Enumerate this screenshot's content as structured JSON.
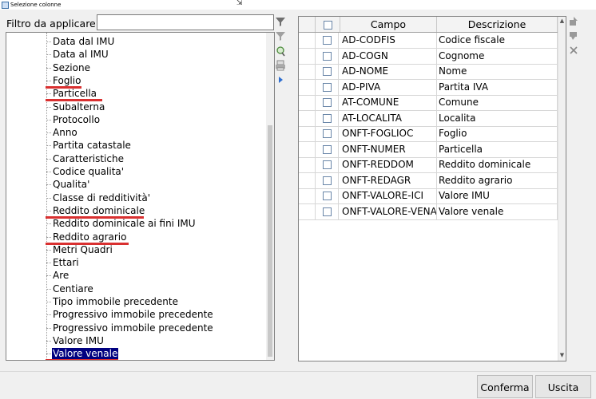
{
  "window": {
    "title": "Selezione colonne"
  },
  "filter": {
    "label": "Filtro da applicare",
    "value": ""
  },
  "tree": {
    "items": [
      "Data dal IMU",
      "Data al IMU",
      "Sezione",
      "Foglio",
      "Particella",
      "Subalterna",
      "Protocollo",
      "Anno",
      "Partita catastale",
      "Caratteristiche",
      "Codice qualita'",
      "Qualita'",
      "Classe di redditività'",
      "Reddito dominicale",
      "Reddito dominicale ai fini IMU",
      "Reddito agrario",
      "Metri Quadri",
      "Ettari",
      "Are",
      "Centiare",
      "Tipo immobile precedente",
      "Progressivo immobile precedente",
      "Progressivo immobile precedente",
      "Valore IMU",
      "Valore venale"
    ],
    "selected": "Valore venale",
    "highlighted": [
      "Foglio",
      "Particella",
      "Reddito dominicale",
      "Reddito agrario",
      "Valore venale"
    ],
    "highlight_color": "#d93030"
  },
  "grid": {
    "columns": {
      "campo": "Campo",
      "descrizione": "Descrizione"
    },
    "rows": [
      {
        "campo": "AD-CODFIS",
        "descrizione": "Codice fiscale"
      },
      {
        "campo": "AD-COGN",
        "descrizione": "Cognome"
      },
      {
        "campo": "AD-NOME",
        "descrizione": "Nome"
      },
      {
        "campo": "AD-PIVA",
        "descrizione": "Partita IVA"
      },
      {
        "campo": "AT-COMUNE",
        "descrizione": "Comune"
      },
      {
        "campo": "AT-LOCALITA",
        "descrizione": "Localita"
      },
      {
        "campo": "ONFT-FOGLIOC",
        "descrizione": "Foglio"
      },
      {
        "campo": "ONFT-NUMER",
        "descrizione": "Particella"
      },
      {
        "campo": "ONFT-REDDOM",
        "descrizione": "Reddito dominicale"
      },
      {
        "campo": "ONFT-REDAGR",
        "descrizione": "Reddito agrario"
      },
      {
        "campo": "ONFT-VALORE-ICI",
        "descrizione": "Valore IMU"
      },
      {
        "campo": "ONFT-VALORE-VENALE",
        "descrizione": "Valore venale"
      }
    ]
  },
  "buttons": {
    "confirm": "Conferma",
    "exit": "Uscita"
  },
  "icons": {
    "middle": [
      "filter-icon",
      "clear-filter-icon",
      "search-icon",
      "print-icon",
      "move-right-icon"
    ],
    "right": [
      "move-up-icon",
      "move-down-icon",
      "remove-icon"
    ]
  }
}
